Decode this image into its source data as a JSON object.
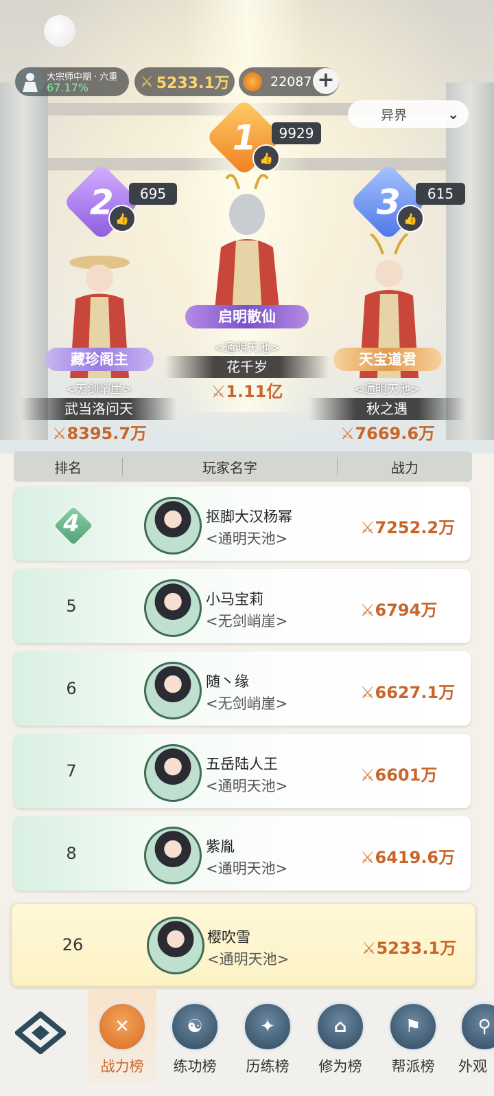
{
  "header": {
    "rank_title": "大宗师中期 · 六重",
    "rank_progress": "67.17%",
    "power": "5233.1万",
    "gems": "22087",
    "server_select": "异界"
  },
  "podium": [
    {
      "place": "1",
      "likes": "9929",
      "title": "启明散仙",
      "guild": "<通明天池>",
      "name": "花千岁",
      "power": "1.11亿"
    },
    {
      "place": "2",
      "likes": "695",
      "title": "藏珍阁主",
      "guild": "<无剑峭崖>",
      "name": "武当洛问天",
      "power": "8395.7万"
    },
    {
      "place": "3",
      "likes": "615",
      "title": "天宝道君",
      "guild": "<通明天池>",
      "name": "秋之遇",
      "power": "7669.6万"
    }
  ],
  "table": {
    "headers": [
      "排名",
      "玩家名字",
      "战力"
    ],
    "rows": [
      {
        "rank": "4",
        "name": "抠脚大汉杨幂",
        "guild": "<通明天池>",
        "power": "7252.2万"
      },
      {
        "rank": "5",
        "name": "小马宝莉",
        "guild": "<无剑峭崖>",
        "power": "6794万"
      },
      {
        "rank": "6",
        "name": "随丶缘",
        "guild": "<无剑峭崖>",
        "power": "6627.1万"
      },
      {
        "rank": "7",
        "name": "五岳陆人王",
        "guild": "<通明天池>",
        "power": "6601万"
      },
      {
        "rank": "8",
        "name": "紫胤",
        "guild": "<通明天池>",
        "power": "6419.6万"
      }
    ],
    "me": {
      "rank": "26",
      "name": "樱吹雪",
      "guild": "<通明天池>",
      "power": "5233.1万"
    }
  },
  "nav": [
    {
      "label": "战力榜",
      "icon": "swords-icon",
      "active": true
    },
    {
      "label": "练功榜",
      "icon": "yin-yang-icon",
      "active": false
    },
    {
      "label": "历练榜",
      "icon": "compass-star-icon",
      "active": false
    },
    {
      "label": "修为榜",
      "icon": "hat-icon",
      "active": false
    },
    {
      "label": "帮派榜",
      "icon": "banner-icon",
      "active": false
    },
    {
      "label": "外观",
      "icon": "fan-icon",
      "active": false
    }
  ],
  "colors": {
    "power": "#c8652a",
    "accent_green": "#4da273",
    "gold": "#ffd46a"
  }
}
